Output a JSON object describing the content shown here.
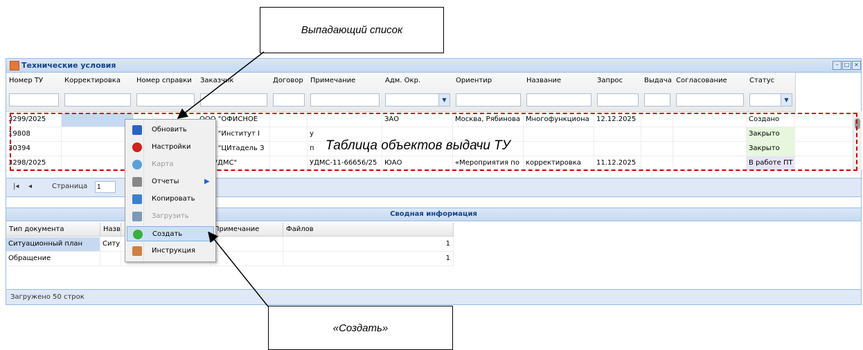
{
  "callouts": {
    "top": "Выпадающий список",
    "bottom": "«Создать»",
    "table_label": "Таблица объектов выдачи ТУ"
  },
  "window": {
    "title": "Технические условия"
  },
  "columns": [
    {
      "label": "Номер ТУ",
      "combo": false
    },
    {
      "label": "Корректировка",
      "combo": false
    },
    {
      "label": "Номер справки",
      "combo": false
    },
    {
      "label": "Заказчик",
      "combo": false
    },
    {
      "label": "Договор",
      "combo": false
    },
    {
      "label": "Примечание",
      "combo": false
    },
    {
      "label": "Адм. Окр.",
      "combo": true
    },
    {
      "label": "Ориентир",
      "combo": false
    },
    {
      "label": "Название",
      "combo": false
    },
    {
      "label": "Запрос",
      "combo": false
    },
    {
      "label": "Выдача",
      "combo": false
    },
    {
      "label": "Согласование",
      "combo": false
    },
    {
      "label": "Статус",
      "combo": true
    }
  ],
  "rows": [
    [
      "3299/2025",
      "",
      "",
      "ООО \"ОФИСНОЕ",
      "",
      "",
      "ЗАО",
      "Москва, Рябинова",
      "Многофункциона",
      "12.12.2025",
      "",
      "",
      "Создано"
    ],
    [
      "19808",
      "",
      "",
      "ООО \"Институт I",
      "",
      "у",
      "",
      "",
      "",
      "",
      "",
      "",
      "Закрыто"
    ],
    [
      "30394",
      "",
      "",
      "ООО \"ЦИтадель З",
      "",
      "п",
      "",
      "",
      "",
      "",
      "",
      "",
      "Закрыто"
    ],
    [
      "3298/2025",
      "",
      "",
      "ГУ \"УДМС\"",
      "",
      "УДМС-11-66656/25",
      "ЮАО",
      "«Мероприятия по",
      "корректировка",
      "11.12.2025",
      "",
      "",
      "В работе ПТ"
    ]
  ],
  "pager": {
    "page_label": "Страница",
    "page_value": "1"
  },
  "summary": {
    "title": "Сводная информация"
  },
  "doc_columns": [
    "Тип документа",
    "Назв",
    "",
    "Примечание",
    "Файлов"
  ],
  "doc_rows": [
    [
      "Ситуационный план",
      "Ситу",
      "",
      "",
      "1"
    ],
    [
      "Обращение",
      "",
      "",
      "",
      "1"
    ]
  ],
  "status_bar": "Загружено 50 строк",
  "context_menu": [
    {
      "label": "Обновить",
      "icon": "refresh-icon",
      "disabled": false
    },
    {
      "label": "Настройки",
      "icon": "settings-icon",
      "disabled": false
    },
    {
      "label": "Карта",
      "icon": "map-icon",
      "disabled": true
    },
    {
      "label": "Отчеты",
      "icon": "reports-icon",
      "disabled": false,
      "submenu": true
    },
    {
      "label": "Копировать",
      "icon": "copy-icon",
      "disabled": false
    },
    {
      "label": "Загрузить",
      "icon": "upload-icon",
      "disabled": true
    },
    {
      "label": "Создать",
      "icon": "create-icon",
      "disabled": false,
      "active": true
    },
    {
      "label": "Инструкция",
      "icon": "instruction-icon",
      "disabled": false
    }
  ],
  "colors": {
    "accent": "#15428b",
    "status_green": "#e6f7dd",
    "status_purple": "#e6e4f7",
    "annotation_red": "#d00000"
  }
}
